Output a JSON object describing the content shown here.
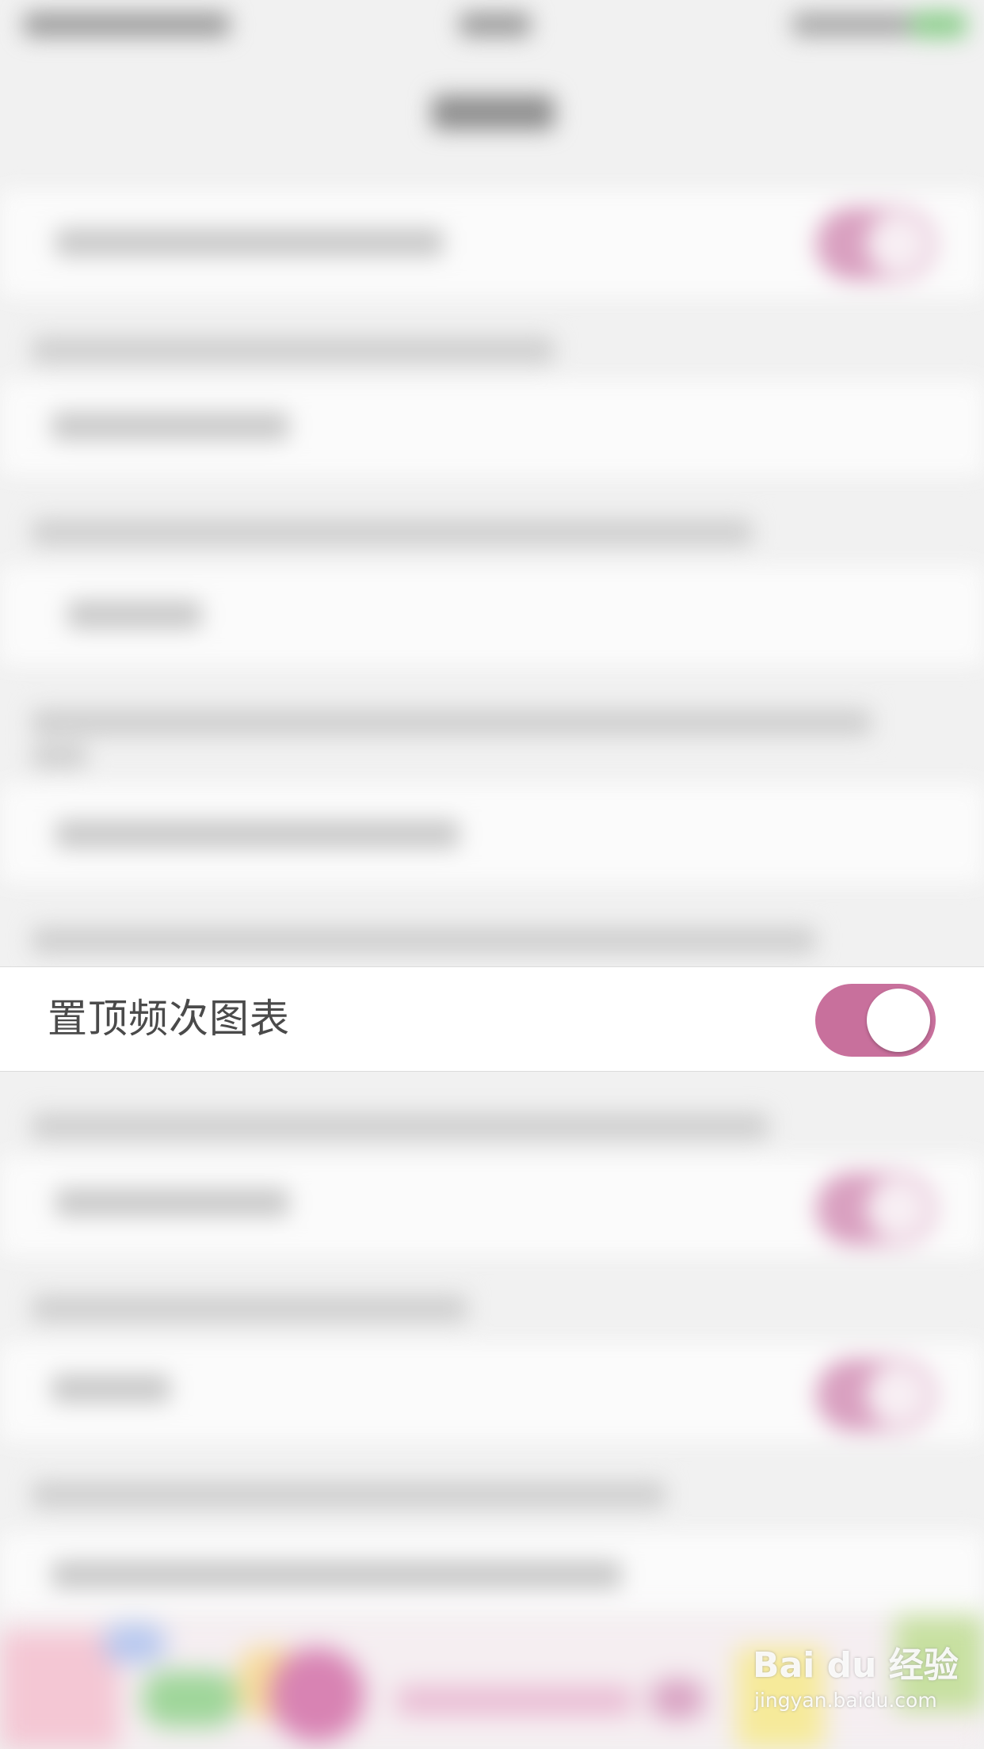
{
  "setting_row": {
    "label": "置顶频次图表",
    "toggle_on": true
  },
  "colors": {
    "toggle_on": "#c8709c",
    "background": "#f1f1f1",
    "row_background": "#ffffff",
    "label_text": "#4a4a4a"
  },
  "watermark": {
    "logo": "Bai du 经验",
    "url": "jingyan.baidu.com"
  }
}
